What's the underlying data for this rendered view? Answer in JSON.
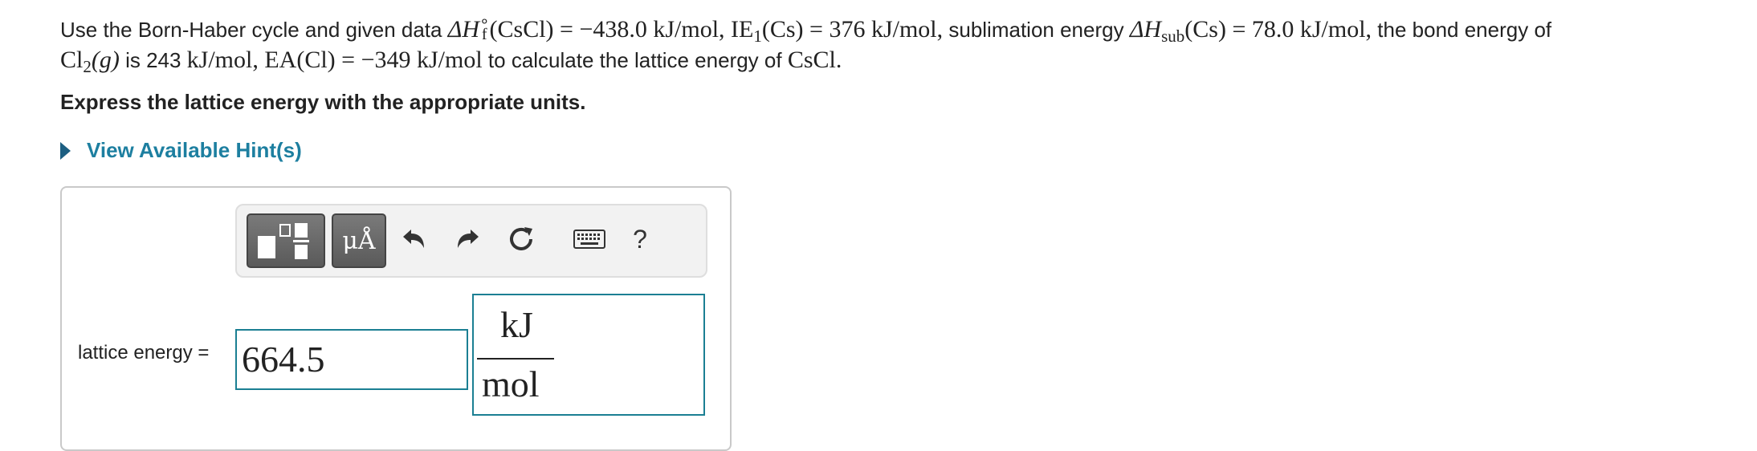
{
  "problem": {
    "p1": "Use the Born-Haber cycle and given data ",
    "dh": "ΔH",
    "f_sup": "∘",
    "f_sub": "f",
    "cscl_val": "(CsCl) = −438.0 kJ/mol, IE",
    "ie_sub": "1",
    "ie_val": "(Cs) = 376 kJ/mol,",
    "p2": " sublimation energy ",
    "dh2": "ΔH",
    "sub_sub": "sub",
    "sub_val": "(Cs) = 78.0 kJ/mol,",
    "p3": " the bond energy of",
    "cl2": "Cl",
    "cl2_sub": "2",
    "cl2_g": "(g)",
    "p4": " is 243 ",
    "be_unit": "kJ/mol, EA(Cl) = −349 kJ/mol",
    "p5": " to calculate the lattice energy of ",
    "cscl": "CsCl.",
    "be_num": ""
  },
  "instruction": "Express the lattice energy with the appropriate units.",
  "hint_label": "View Available Hint(s)",
  "toolbar": {
    "units_label": "μÅ",
    "icons": [
      "templates-icon",
      "units-icon",
      "undo-icon",
      "redo-icon",
      "reset-icon",
      "keyboard-icon",
      "help-icon"
    ],
    "help_label": "?"
  },
  "answer": {
    "label": "lattice energy =",
    "value": "664.5",
    "unit_numerator": "kJ",
    "unit_denominator": "mol"
  },
  "colors": {
    "link": "#1d7fa0",
    "input_border": "#1b7f93",
    "toolbar_button": "#666666"
  }
}
